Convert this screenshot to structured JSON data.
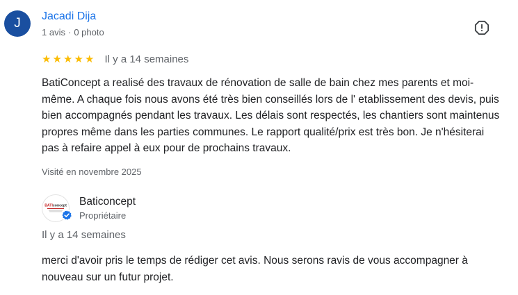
{
  "review": {
    "author_initial": "J",
    "author_name": "Jacadi Dija",
    "review_count": "1 avis",
    "separator": "·",
    "photo_count": "0 photo",
    "rating": 5,
    "rating_max": 5,
    "date": "Il y a 14 semaines",
    "text": "BatiConcept a realisé des travaux de rénovation de salle de bain chez mes parents et moi-même. A chaque fois nous avons été très bien conseillés lors de l' etablissement des devis, puis bien accompagnés pendant les travaux. Les délais sont respectés, les chantiers sont maintenus propres même dans les parties communes. Le rapport qualité/prix est très bon. Je n'hésiterai pas à refaire appel à eux pour de prochains travaux.",
    "visited": "Visité en novembre 2025"
  },
  "owner_reply": {
    "name": "Baticoncept",
    "role": "Propriétaire",
    "date": "Il y a 14 semaines",
    "text": "merci d'avoir pris le temps de rédiger cet avis. Nous serons ravis de vous accompagner à nouveau sur un futur projet.",
    "logo_text": "BATIconcept"
  },
  "colors": {
    "accent": "#1a73e8",
    "avatar_bg": "#1a4fa0",
    "star": "#fbbc04",
    "verified": "#1a73e8",
    "secondary_text": "#5f6368"
  },
  "icons": {
    "report": "report-flag-icon",
    "star": "star-icon",
    "verified": "verified-check-icon"
  }
}
